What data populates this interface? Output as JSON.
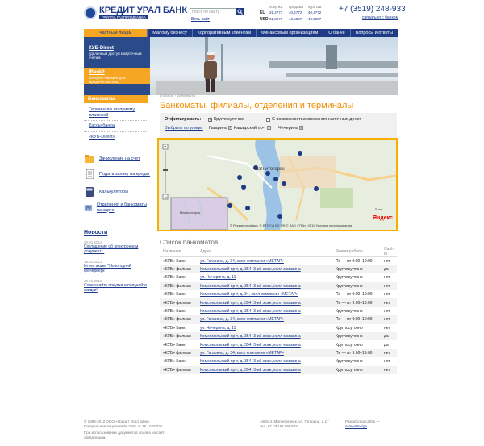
{
  "header": {
    "logo_name": "КРЕДИТ УРАЛ БАНК",
    "logo_sub": "ГРУППА ГАЗПРОМБАНКА",
    "search_placeholder": "поиск по сайту",
    "all_site": "Весь сайт",
    "rates": {
      "cols": [
        "покупка",
        "продажа",
        "курс ЦБ"
      ],
      "rows": [
        {
          "cur": "EU",
          "buy": "31,4777",
          "sell": "40,4772",
          "cb": "40,4772"
        },
        {
          "cur": "USD",
          "buy": "31,3577",
          "sell": "40,5867",
          "cb": "40,5867"
        }
      ]
    },
    "phone": "+7 (3519) 248-933",
    "contact_link": "связаться с банком"
  },
  "nav": [
    "Частным лицам",
    "Малому бизнесу",
    "Корпоративным клиентам",
    "Финансовым организациям",
    "О банке",
    "Вопросы и ответы"
  ],
  "promos": [
    {
      "title": "КУБ-Direct",
      "desc": "удаленный доступ к карточным счетам"
    },
    {
      "title": "IBank2",
      "desc": "интернет-банкинг для юридических лиц"
    }
  ],
  "breadcrumb": "Главная › Банкоматы",
  "page_title": "Банкоматы, филиалы, отделения и терминалы",
  "left_menu": {
    "head": "Банкоматы",
    "items": [
      "Терминалы по приему платежей",
      "Кассы банка",
      "«КУБ-Direct»"
    ]
  },
  "tools": [
    "Зачисление на счет",
    "Подать заявку на кредит",
    "Калькуляторы",
    "Отделения и банкоматы на карте"
  ],
  "news": {
    "title": "Новости",
    "items": [
      {
        "date": "20.01.2012",
        "text": "Соглашение об электронном документ..."
      },
      {
        "date": "18.01.2012",
        "text": "Итоги акции \"Новогодний фейерверк\""
      },
      {
        "date": "18.01.2012",
        "text": "Совершайте покупки и получайте скидки!"
      }
    ]
  },
  "filter": {
    "label": "Отфильтровать:",
    "round_the_clock": "Круглосуточно",
    "cash_in": "С возможностью внесения наличных денег",
    "street_link": "Выбрать по улице:",
    "tags": [
      "Гагарина",
      "Каширский пр-т",
      "Чичерина"
    ]
  },
  "map": {
    "city": "Магнитогорск",
    "overview_city": "Магнитогорск",
    "copyright": "© Роскартография, © ВТУ ГШ ВС РФ © ЗАО «ТГА», 2010 Условия использования",
    "logo": "Яндекс",
    "scale": "5 км"
  },
  "list": {
    "title": "Список банкоматов",
    "columns": [
      "Название",
      "Адрес",
      "Режим работы",
      "Cash In"
    ],
    "rows": [
      [
        "«КУБ» Банк",
        "ул. Гагарина, д. 34, колл компании «МЕТАР»",
        "Пн — пт 9:00–19:00",
        "нет"
      ],
      [
        "«КУБ» филиал",
        "Комсомольский пр-т, д. 354, 3-ий этаж, колл магазина",
        "Круглосуточно",
        "да"
      ],
      [
        "«КУБ» Банк",
        "ул. Чичерина, д. 11",
        "Круглосуточно",
        "нет"
      ],
      [
        "«КУБ» филиал",
        "Комсомольский пр-т, д. 354, 3-ий этаж, колл магазина",
        "Круглосуточно",
        "нет"
      ],
      [
        "«КУБ» Банк",
        "Комсомольский пр-т, д. 34, колл компании «МЕТАР»",
        "Пн — пт 9:00–19:00",
        "нет"
      ],
      [
        "«КУБ» филиал",
        "Комсомольский пр-т, д. 354, 3-ий этаж, колл магазина",
        "Пн — пт 9:00–19:00",
        "нет"
      ],
      [
        "«КУБ» Банк",
        "Комсомольский пр-т, д. 354, 3-ий этаж, колл магазина",
        "Круглосуточно",
        "нет"
      ],
      [
        "«КУБ» филиал",
        "ул. Гагарина, д. 34, колл компании «МЕТАР»",
        "Пн — пт 9:00–19:00",
        "нет"
      ],
      [
        "«КУБ» Банк",
        "ул. Чичерина, д. 11",
        "Круглосуточно",
        "нет"
      ],
      [
        "«КУБ» филиал",
        "Комсомольский пр-т, д. 354, 3-ий этаж, колл магазина",
        "Круглосуточно",
        "да"
      ],
      [
        "«КУБ» Банк",
        "Комсомольский пр-т, д. 354, 3-ий этаж, колл магазина",
        "Круглосуточно",
        "да"
      ],
      [
        "«КУБ» филиал",
        "ул. Гагарина, д. 34, колл компании «МЕТАР»",
        "Пн — пт 9:00–19:00",
        "нет"
      ],
      [
        "«КУБ» Банк",
        "Комсомольский пр-т, д. 354, 3-ий этаж, колл магазина",
        "Круглосуточно",
        "нет"
      ],
      [
        "«КУБ» филиал",
        "Комсомольский пр-т, д. 354, 3-ий этаж, колл магазина",
        "Круглосуточно",
        "нет"
      ]
    ]
  },
  "footer": {
    "copyright": "© 1998-2012 ООО «Кредит Урал Банк»",
    "license": "Генеральная лицензия № 2584 от 16.10.2003 г.",
    "note": "При использовании документов ссылка на сайт обязательна.",
    "address": "455044, Магнитогорск, ул. Гагарина, д.17",
    "phone": "тел. +7 (3519) 248-933",
    "dev_label": "Разработка сайта —",
    "dev_link": "ArmexDesign"
  },
  "colors": {
    "brand_blue": "#1f3b86",
    "accent_orange": "#f5a623",
    "title_orange": "#f08c00"
  }
}
